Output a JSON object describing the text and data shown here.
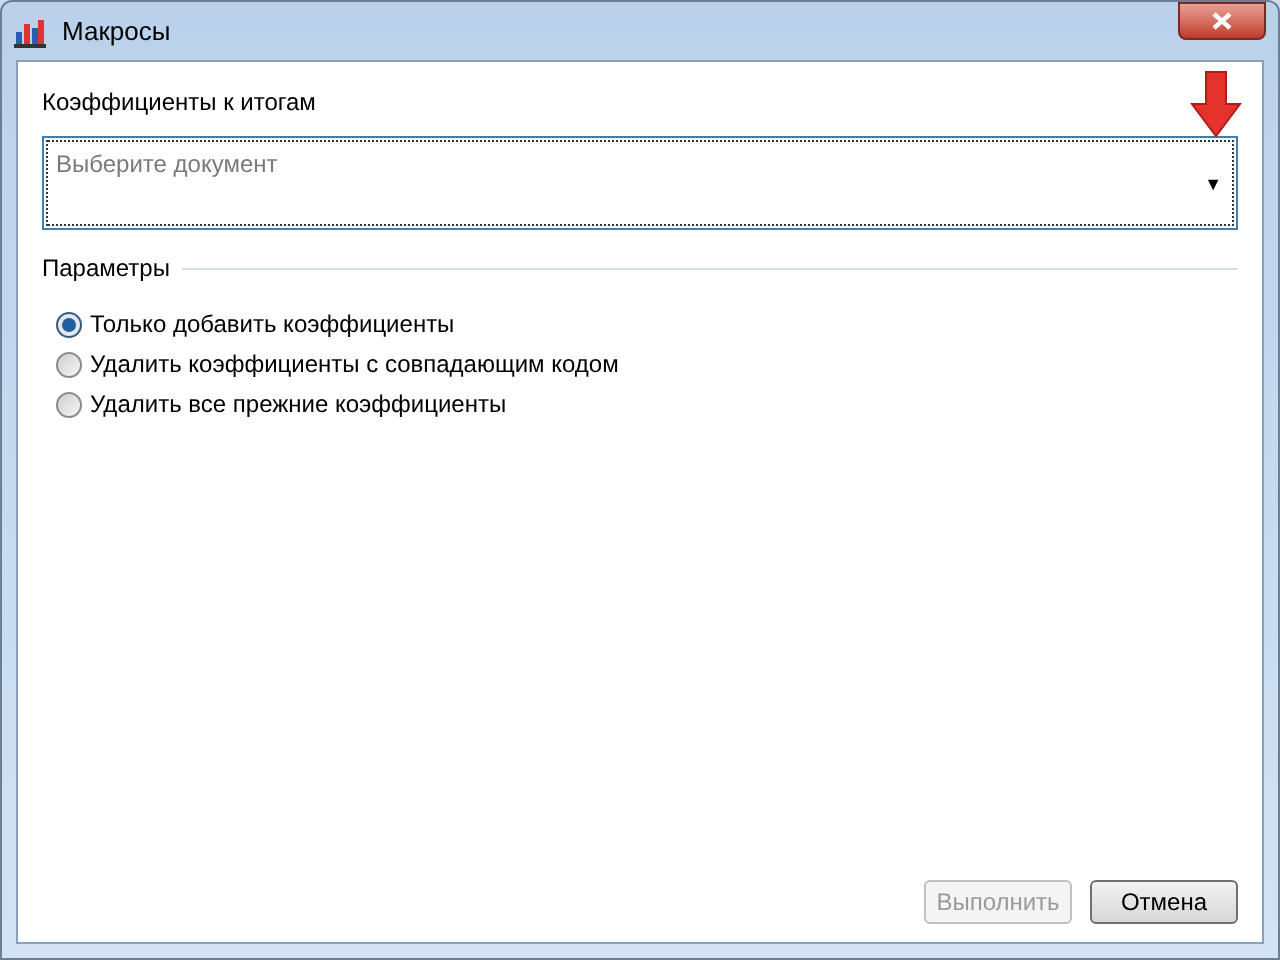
{
  "window": {
    "title": "Макросы"
  },
  "document_label": "Коэффициенты к итогам",
  "document_select": {
    "placeholder": "Выберите документ",
    "arrow": "▼"
  },
  "parameters": {
    "title": "Параметры",
    "options": [
      {
        "label": "Только добавить коэффициенты",
        "selected": true
      },
      {
        "label": "Удалить коэффициенты с совпадающим кодом",
        "selected": false
      },
      {
        "label": "Удалить все прежние коэффициенты",
        "selected": false
      }
    ]
  },
  "buttons": [
    {
      "label": "Выполнить",
      "disabled": true
    },
    {
      "label": "Отмена",
      "disabled": false
    }
  ]
}
